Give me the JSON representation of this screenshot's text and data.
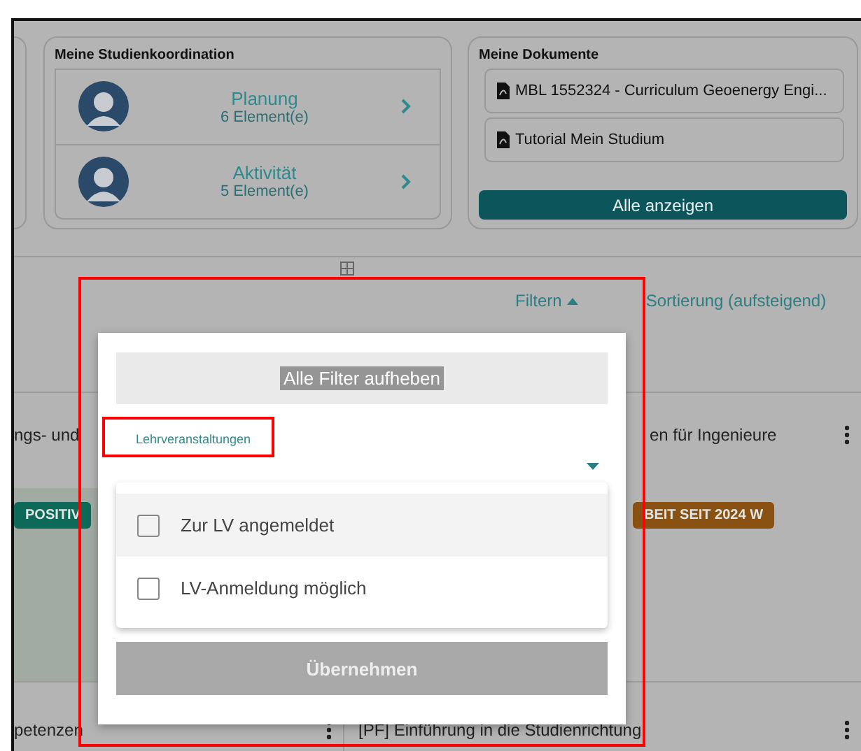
{
  "study_coordination": {
    "title": "Meine Studienkoordination",
    "items": [
      {
        "label": "Planung",
        "count": "6 Element(e)"
      },
      {
        "label": "Aktivität",
        "count": "5 Element(e)"
      }
    ]
  },
  "documents": {
    "title": "Meine Dokumente",
    "items": [
      "MBL 1552324 - Curriculum Geoenergy Engi...",
      "Tutorial Mein Studium"
    ],
    "show_all": "Alle anzeigen"
  },
  "toolbar": {
    "filter": {
      "label": "Filtern",
      "expanded": true
    },
    "sort": "Sortierung (aufsteigend)"
  },
  "courses": [
    {
      "title": "ngs- und",
      "badge": {
        "label": "POSITIV",
        "color": "#0e6a58"
      }
    },
    {
      "title": "en für Ingenieure",
      "badge": {
        "label": "BEIT SEIT 2024 W",
        "color": "#8a5212"
      }
    },
    {
      "title": "petenzen"
    },
    {
      "title": "[PF] Einführung in die Studienrichtung"
    }
  ],
  "filter_popup": {
    "clear_button": "Alle Filter aufheben",
    "field_label": "Lehrveranstaltungen",
    "options": [
      {
        "label": "Zur LV angemeldet",
        "checked": false,
        "selected": true
      },
      {
        "label": "LV-Anmeldung möglich",
        "checked": false,
        "selected": false
      }
    ],
    "apply_button": "Übernehmen"
  }
}
